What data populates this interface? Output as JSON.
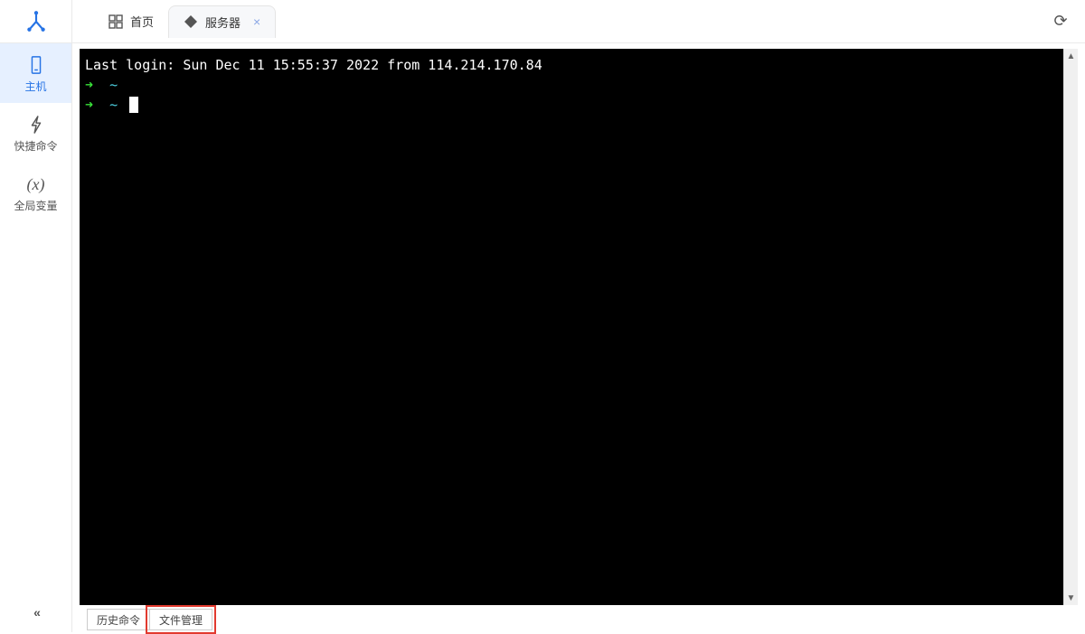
{
  "sidebar": {
    "items": [
      {
        "label": "主机",
        "icon": "host"
      },
      {
        "label": "快捷命令",
        "icon": "lightning"
      },
      {
        "label": "全局变量",
        "icon": "var"
      }
    ],
    "collapse_glyph": "«"
  },
  "tabs": [
    {
      "label": "首页",
      "icon": "dashboard",
      "closable": false
    },
    {
      "label": "服务器",
      "icon": "server",
      "closable": true
    }
  ],
  "terminal": {
    "login_line": "Last login: Sun Dec 11 15:55:37 2022 from 114.214.170.84",
    "prompt_arrow": "➜",
    "prompt_path": "~"
  },
  "bottom_tabs": [
    {
      "label": "历史命令"
    },
    {
      "label": "文件管理"
    }
  ],
  "icons": {
    "refresh": "⟳",
    "close": "×",
    "scroll_up": "▲",
    "scroll_down": "▼"
  }
}
